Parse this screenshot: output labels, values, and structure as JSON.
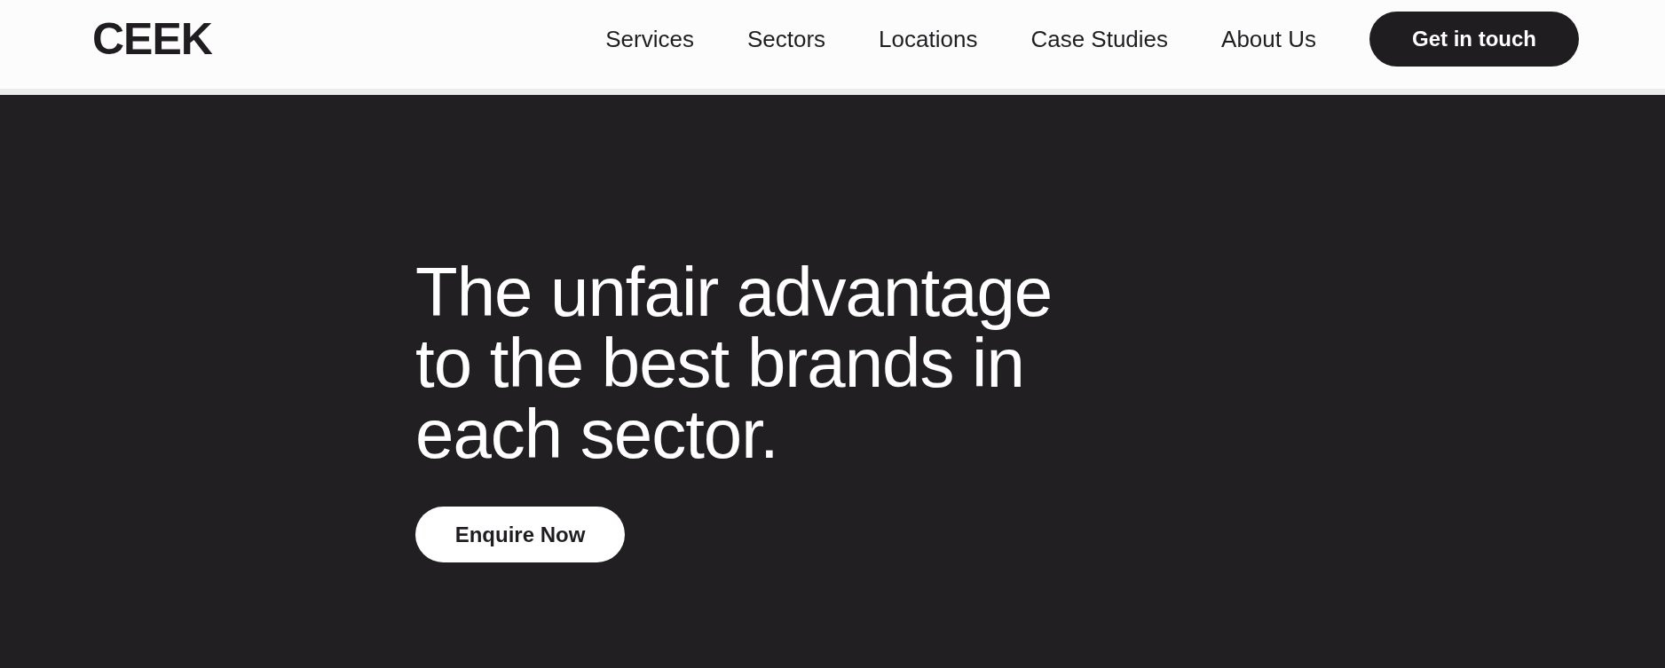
{
  "header": {
    "logo": "CEEK",
    "nav": [
      {
        "label": "Services"
      },
      {
        "label": "Sectors"
      },
      {
        "label": "Locations"
      },
      {
        "label": "Case Studies"
      },
      {
        "label": "About Us"
      }
    ],
    "cta": "Get in touch"
  },
  "hero": {
    "headline": "The unfair advantage to the best brands in each sector.",
    "button": "Enquire Now"
  }
}
